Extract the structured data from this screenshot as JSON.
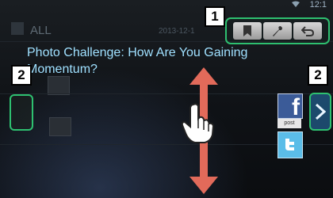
{
  "status": {
    "time": "12:1"
  },
  "list": {
    "header": "ALL",
    "rows": [
      {
        "text": "2013-12-1"
      },
      {
        "text": "Photo Challenge: How Are You Gaining"
      },
      {
        "text": "Momentum?"
      }
    ]
  },
  "post": {
    "title": "Photo Challenge: How Are You Gaining Momentum?"
  },
  "callouts": {
    "toolbar": "1",
    "scroll_left": "2",
    "scroll_right": "2"
  },
  "toolbar": {
    "icons": [
      "bookmark-icon",
      "tune-icon",
      "back-icon"
    ]
  },
  "social": {
    "facebook_glyph": "f",
    "post_label": "post"
  },
  "colors": {
    "highlight": "#2ec070",
    "title_text": "#9fe0ff",
    "arrow": "#e26a5a"
  }
}
